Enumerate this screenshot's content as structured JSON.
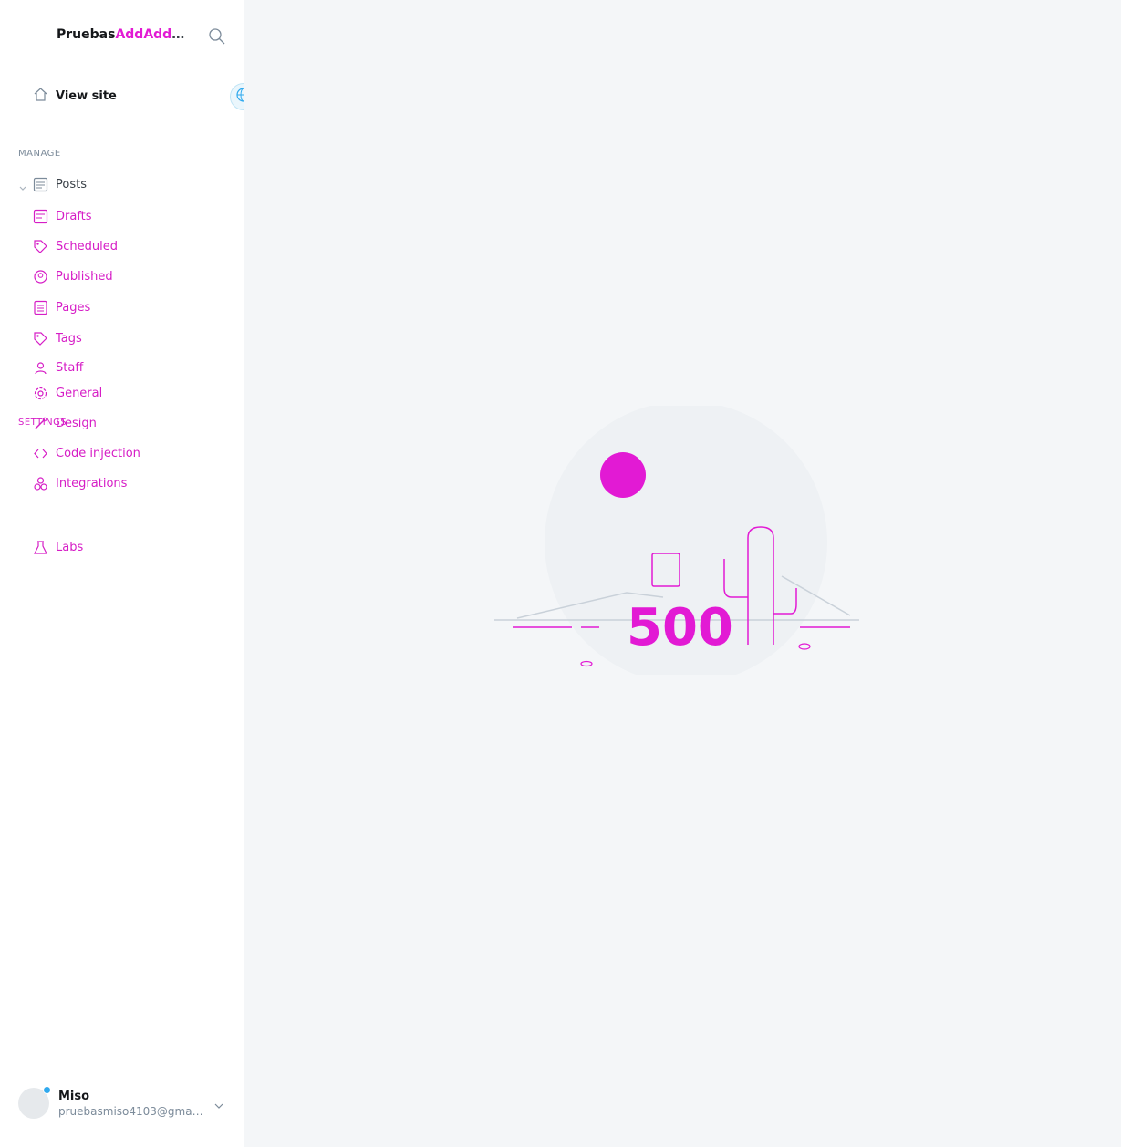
{
  "sidebar": {
    "site_title_dark": "Pruebas",
    "site_title_accent": "AddAddA...",
    "view_site_label": "View site",
    "manage_label": "MANAGE",
    "posts_label": "Posts",
    "drafts_label": "Drafts",
    "scheduled_label": "Scheduled",
    "published_label": "Published",
    "pages_label": "Pages",
    "tags_label": "Tags",
    "staff_label": "Staff",
    "settings_label": "SETTINGS",
    "general_label": "General",
    "design_label": "Design",
    "code_injection_label": "Code injection",
    "integrations_label": "Integrations",
    "labs_label": "Labs"
  },
  "user": {
    "name": "Miso",
    "email": "pruebasmiso4103@gmai..."
  },
  "main": {
    "error_code": "500"
  },
  "colors": {
    "accent": "#e21ad4",
    "main_bg": "#f4f6f8",
    "text": "#394047"
  }
}
